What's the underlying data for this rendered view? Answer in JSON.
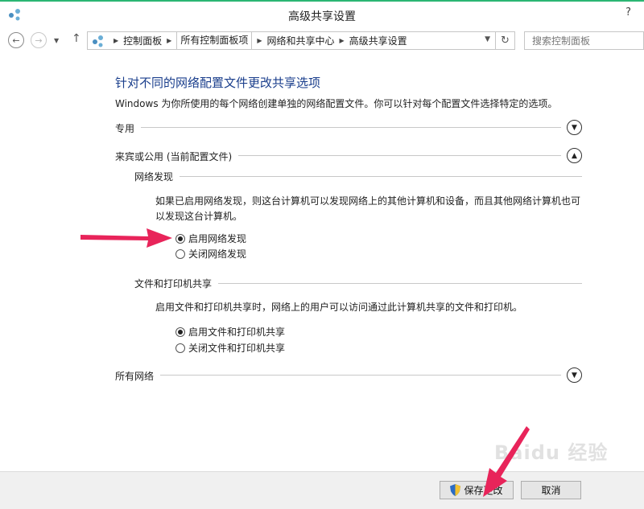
{
  "window": {
    "title": "高级共享设置",
    "help_label": "?"
  },
  "nav": {
    "back_icon": "back-arrow-icon",
    "forward_icon": "forward-arrow-icon",
    "up_icon": "up-arrow-icon",
    "breadcrumb": [
      "控制面板",
      "所有控制面板项",
      "网络和共享中心",
      "高级共享设置"
    ],
    "search_placeholder": "搜索控制面板"
  },
  "main": {
    "heading": "针对不同的网络配置文件更改共享选项",
    "description": "Windows 为你所使用的每个网络创建单独的网络配置文件。你可以针对每个配置文件选择特定的选项。",
    "profiles": {
      "private": {
        "label": "专用",
        "expanded": false
      },
      "guest_public": {
        "label": "来宾或公用 (当前配置文件)",
        "expanded": true
      },
      "all_networks": {
        "label": "所有网络",
        "expanded": false
      }
    },
    "network_discovery": {
      "title": "网络发现",
      "description": "如果已启用网络发现，则这台计算机可以发现网络上的其他计算机和设备，而且其他网络计算机也可以发现这台计算机。",
      "options": [
        {
          "label": "启用网络发现",
          "selected": true
        },
        {
          "label": "关闭网络发现",
          "selected": false
        }
      ]
    },
    "file_printer_sharing": {
      "title": "文件和打印机共享",
      "description": "启用文件和打印机共享时，网络上的用户可以访问通过此计算机共享的文件和打印机。",
      "options": [
        {
          "label": "启用文件和打印机共享",
          "selected": true
        },
        {
          "label": "关闭文件和打印机共享",
          "selected": false
        }
      ]
    }
  },
  "footer": {
    "save_label": "保存更改",
    "cancel_label": "取消"
  },
  "watermark": "Baidu 经验",
  "colors": {
    "heading": "#1a3e8c",
    "accent_border": "#2bb673",
    "annotation_arrow": "#e8245a"
  }
}
